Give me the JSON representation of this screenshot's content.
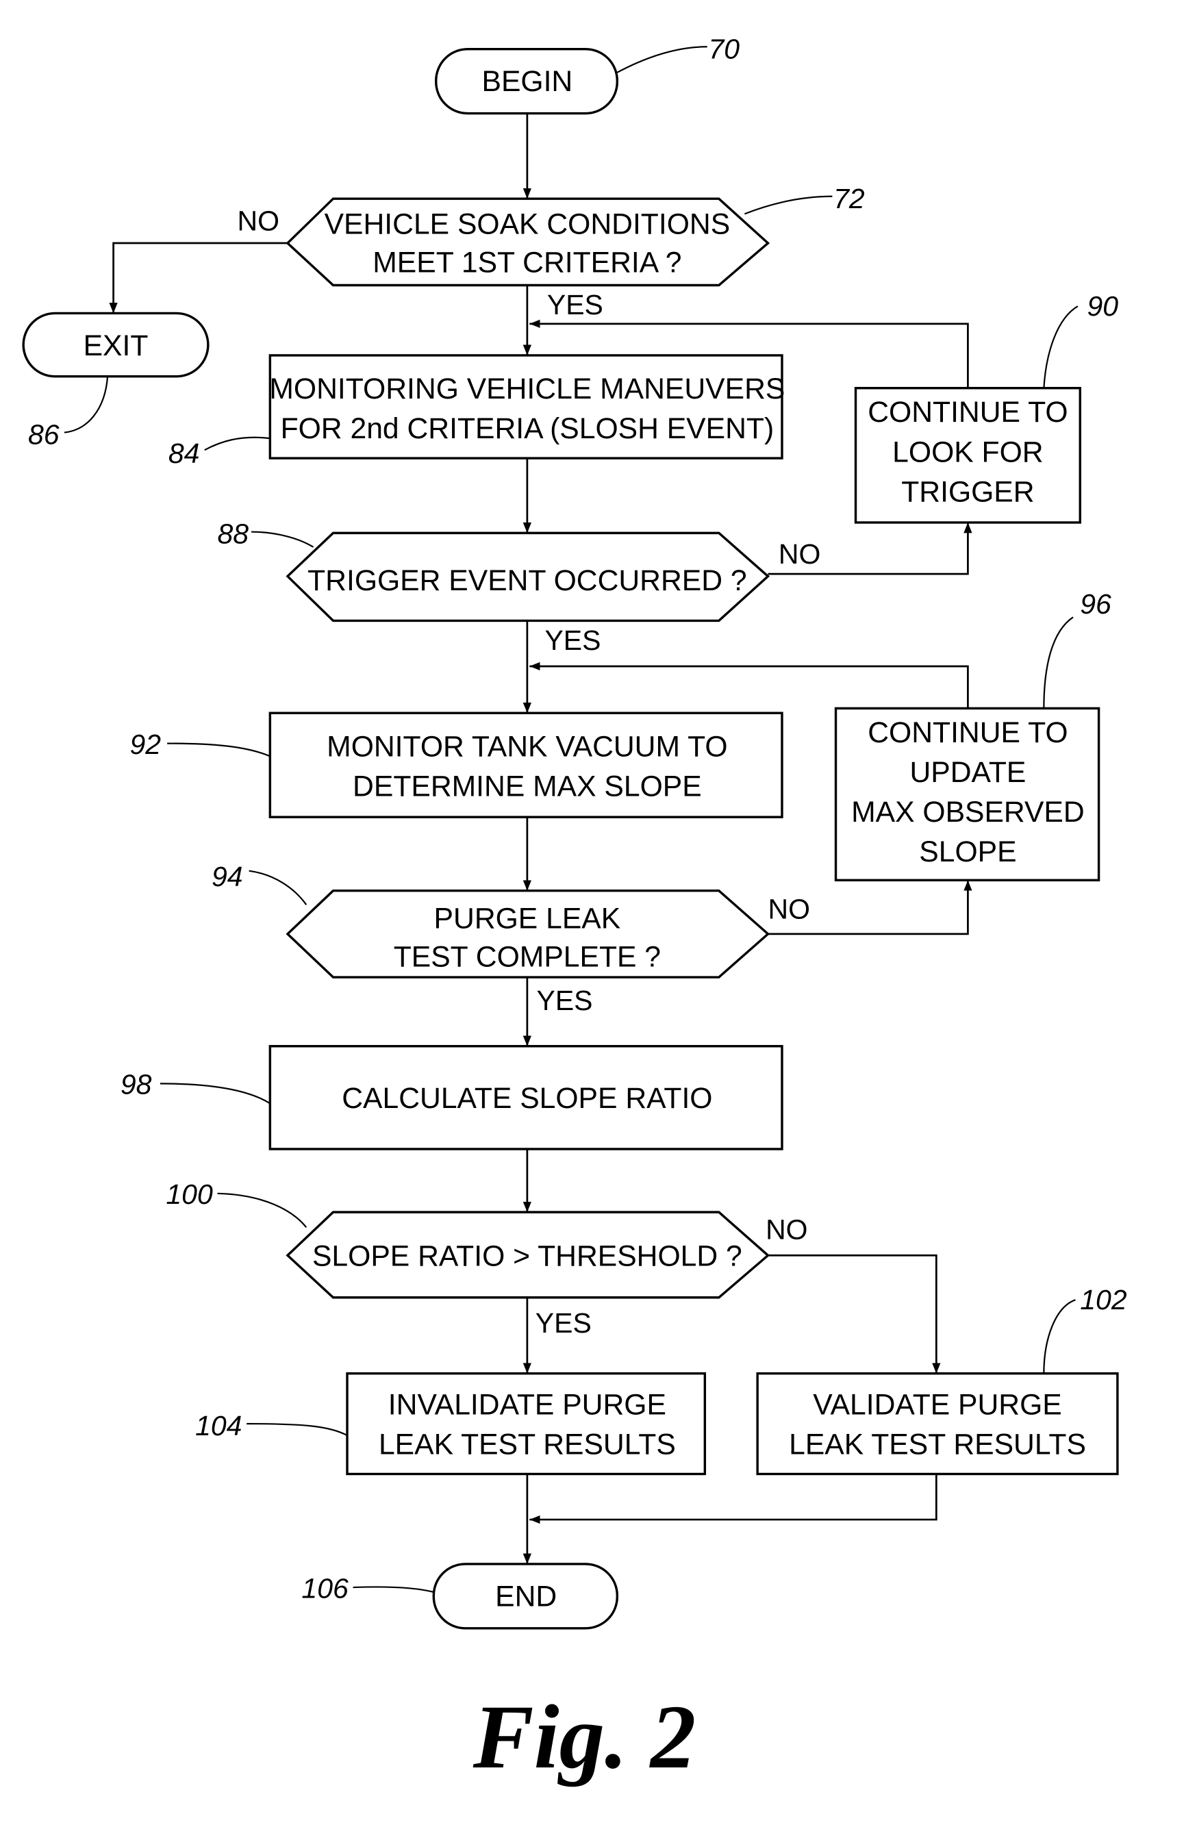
{
  "figure_label": "Fig. 2",
  "nodes": {
    "begin": {
      "ref": "70",
      "text": "BEGIN"
    },
    "soak": {
      "ref": "72",
      "lines": [
        "VEHICLE SOAK CONDITIONS",
        "MEET 1ST CRITERIA ?"
      ]
    },
    "exit": {
      "ref": "86",
      "text": "EXIT"
    },
    "monitor_maneuvers": {
      "ref": "84",
      "lines": [
        "MONITORING VEHICLE MANEUVERS",
        "FOR 2nd CRITERIA (SLOSH EVENT)"
      ]
    },
    "continue_trigger": {
      "ref": "90",
      "lines": [
        "CONTINUE TO",
        "LOOK FOR",
        "TRIGGER"
      ]
    },
    "trigger": {
      "ref": "88",
      "lines": [
        "TRIGGER EVENT OCCURRED ?"
      ]
    },
    "monitor_vacuum": {
      "ref": "92",
      "lines": [
        "MONITOR TANK VACUUM TO",
        "DETERMINE MAX SLOPE"
      ]
    },
    "continue_update": {
      "ref": "96",
      "lines": [
        "CONTINUE TO",
        "UPDATE",
        "MAX OBSERVED",
        "SLOPE"
      ]
    },
    "purge_complete": {
      "ref": "94",
      "lines": [
        "PURGE LEAK",
        "TEST COMPLETE ?"
      ]
    },
    "calc_ratio": {
      "ref": "98",
      "lines": [
        "CALCULATE SLOPE RATIO"
      ]
    },
    "threshold": {
      "ref": "100",
      "lines": [
        "SLOPE RATIO > THRESHOLD ?"
      ]
    },
    "validate": {
      "ref": "102",
      "lines": [
        "VALIDATE PURGE",
        "LEAK TEST RESULTS"
      ]
    },
    "invalidate": {
      "ref": "104",
      "lines": [
        "INVALIDATE PURGE",
        "LEAK TEST RESULTS"
      ]
    },
    "end": {
      "ref": "106",
      "text": "END"
    }
  },
  "edge_labels": {
    "yes": "YES",
    "no": "NO"
  }
}
